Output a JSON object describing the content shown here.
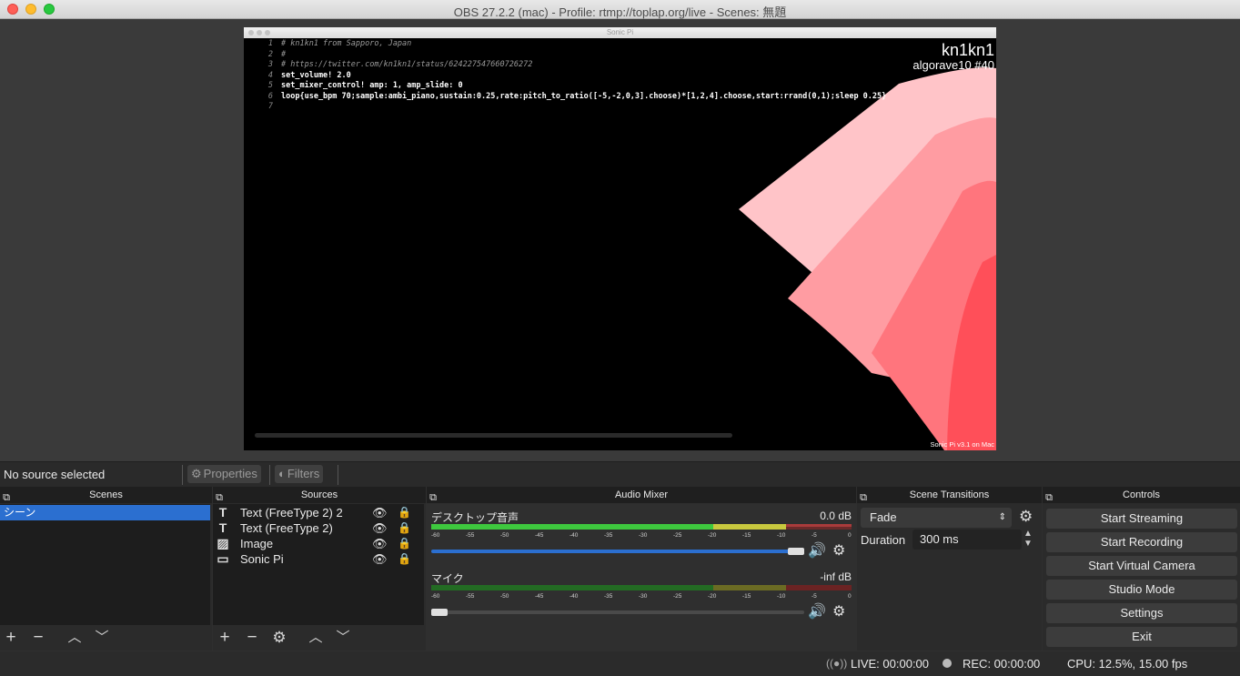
{
  "window": {
    "title": "OBS 27.2.2 (mac) - Profile: rtmp://toplap.org/live - Scenes: 無題"
  },
  "preview": {
    "app_title": "Sonic Pi",
    "code_lines": [
      {
        "n": "1",
        "text": "# kn1kn1 from Sapporo, Japan"
      },
      {
        "n": "2",
        "text": "#"
      },
      {
        "n": "3",
        "text": "# https://twitter.com/kn1kn1/status/624227547660726272"
      },
      {
        "n": "4",
        "text": "set_volume! 2.0"
      },
      {
        "n": "5",
        "text": "set_mixer_control! amp: 1, amp_slide: 0"
      },
      {
        "n": "6",
        "text": "loop{use_bpm 70;sample:ambi_piano,sustain:0.25,rate:pitch_to_ratio([-5,-2,0,3].choose)*[1,2,4].choose,start:rrand(0,1);sleep 0.25}"
      },
      {
        "n": "7",
        "text": ""
      }
    ],
    "overlay_name": "kn1kn1",
    "overlay_event": "algorave10 #40",
    "footer": "Sonic Pi v3.1 on Mac"
  },
  "context_bar": {
    "no_source": "No source selected",
    "properties": "Properties",
    "filters": "Filters"
  },
  "scenes": {
    "header": "Scenes",
    "items": [
      "シーン"
    ]
  },
  "sources": {
    "header": "Sources",
    "items": [
      {
        "label": "Text (FreeType 2) 2",
        "icon": "text-icon"
      },
      {
        "label": "Text (FreeType 2)",
        "icon": "text-icon"
      },
      {
        "label": "Image",
        "icon": "image-icon"
      },
      {
        "label": "Sonic Pi",
        "icon": "window-capture-icon"
      }
    ]
  },
  "mixer": {
    "header": "Audio Mixer",
    "ticks": [
      "-60",
      "-55",
      "-50",
      "-45",
      "-40",
      "-35",
      "-30",
      "-25",
      "-20",
      "-15",
      "-10",
      "-5",
      "0"
    ],
    "tracks": [
      {
        "name": "デスクトップ音声",
        "db": "0.0 dB",
        "volume": 1.0
      },
      {
        "name": "マイク",
        "db": "-inf dB",
        "volume": 0.0
      }
    ]
  },
  "transitions": {
    "header": "Scene Transitions",
    "selected": "Fade",
    "duration_label": "Duration",
    "duration_value": "300 ms"
  },
  "controls": {
    "header": "Controls",
    "buttons": [
      "Start Streaming",
      "Start Recording",
      "Start Virtual Camera",
      "Studio Mode",
      "Settings",
      "Exit"
    ]
  },
  "status": {
    "live": "LIVE: 00:00:00",
    "rec": "REC: 00:00:00",
    "cpu": "CPU: 12.5%, 15.00 fps"
  },
  "colors": {
    "accent": "#2b6fd0",
    "meter_green": "#3ec83e",
    "meter_yellow": "#c8c83e",
    "meter_red": "#c83e3e"
  }
}
